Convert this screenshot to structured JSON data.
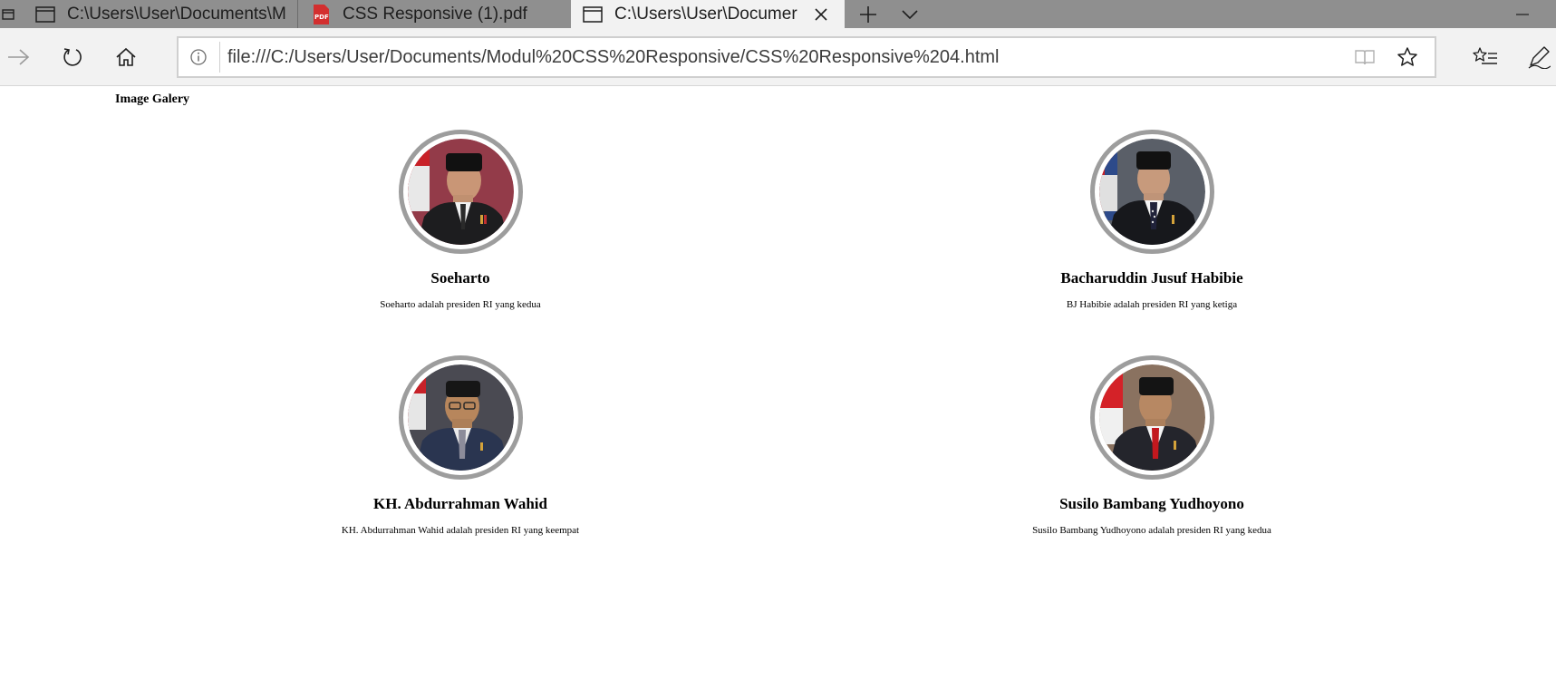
{
  "browser": {
    "tabs": [
      {
        "title": "C:\\Users\\User\\Documents\\M",
        "icon": "page-icon",
        "active": false
      },
      {
        "title": "CSS Responsive (1).pdf",
        "icon": "pdf-icon",
        "active": false
      },
      {
        "title": "C:\\Users\\User\\Documer",
        "icon": "page-icon",
        "active": true
      }
    ],
    "address_url": "file:///C:/Users/User/Documents/Modul%20CSS%20Responsive/CSS%20Responsive%204.html",
    "colors": {
      "tabbar": "#8f8f8f",
      "active_tab": "#f2f2f2",
      "toolbar": "#f2f2f2"
    }
  },
  "page": {
    "heading": "Image Galery",
    "cards": [
      {
        "name": "Soeharto",
        "description": "Soeharto adalah presiden RI yang kedua",
        "flag_side": "left"
      },
      {
        "name": "Bacharuddin Jusuf Habibie",
        "description": "BJ Habibie adalah presiden RI yang ketiga",
        "flag_side": "left"
      },
      {
        "name": "KH. Abdurrahman Wahid",
        "description": "KH. Abdurrahman Wahid adalah presiden RI yang keempat",
        "flag_side": "left"
      },
      {
        "name": "Susilo Bambang Yudhoyono",
        "description": "Susilo Bambang Yudhoyono adalah presiden RI yang kedua",
        "flag_side": "left"
      }
    ],
    "colors": {
      "avatar_ring": "#9d9d9d"
    }
  }
}
